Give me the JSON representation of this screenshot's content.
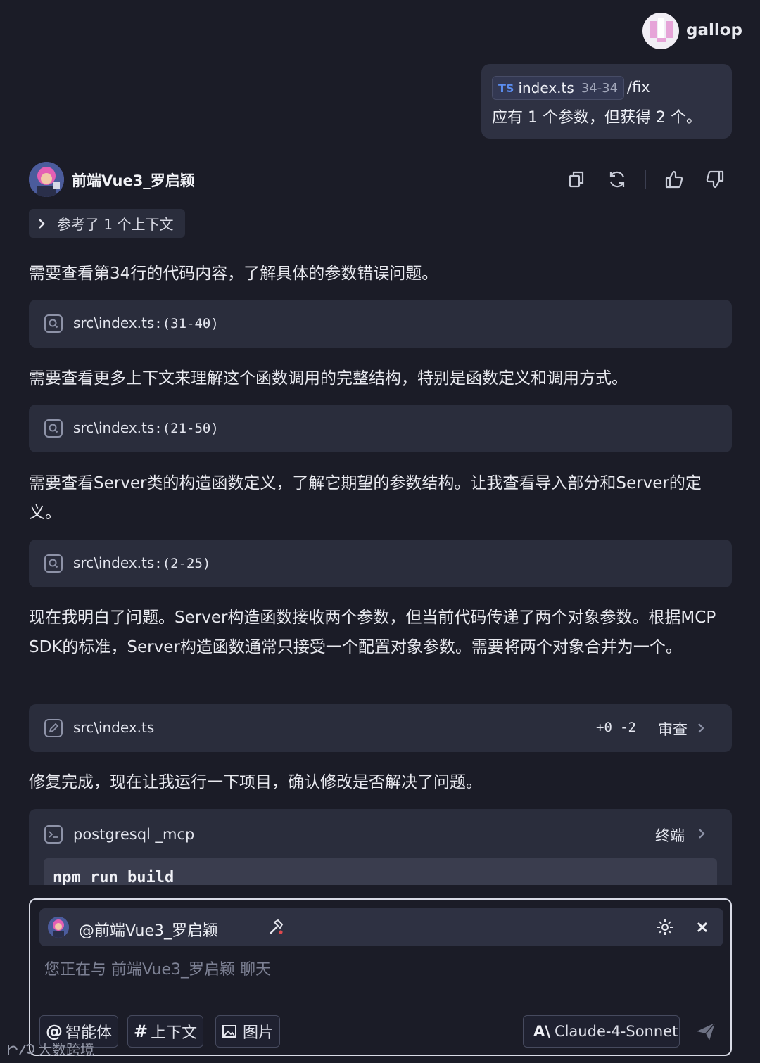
{
  "user": {
    "name": "gallop",
    "chip_badge": "TS",
    "chip_file": "index.ts",
    "chip_range": "34-34",
    "command": "/fix",
    "message": "应有 1 个参数，但获得 2 个。"
  },
  "agent": {
    "name": "前端Vue3_罗启颖",
    "reference": "参考了 1 个上下文"
  },
  "messages": {
    "p1": "需要查看第34行的代码内容，了解具体的参数错误问题。",
    "p2": "需要查看更多上下文来理解这个函数调用的完整结构，特别是函数定义和调用方式。",
    "p3": "需要查看Server类的构造函数定义，了解它期望的参数结构。让我查看导入部分和Server的定义。",
    "p4": "现在我明白了问题。Server构造函数接收两个参数，但当前代码传递了两个对象参数。根据MCP SDK的标准，Server构造函数通常只接受一个配置对象参数。需要将两个对象合并为一个。",
    "p5": "修复完成，现在让我运行一下项目，确认修改是否解决了问题。"
  },
  "cards": {
    "search1": {
      "file": "src\\index.ts",
      "range": ":(31-40)"
    },
    "search2": {
      "file": "src\\index.ts",
      "range": ":(21-50)"
    },
    "search3": {
      "file": "src\\index.ts",
      "range": ":(2-25)"
    },
    "edit": {
      "file": "src\\index.ts",
      "added": "+0",
      "removed": "-2",
      "action": "审查"
    },
    "terminal": {
      "project": "postgresql _mcp",
      "action": "终端",
      "command": "npm run build"
    }
  },
  "input": {
    "mention": "@前端Vue3_罗启颖",
    "placeholder": "您正在与 前端Vue3_罗启颖 聊天",
    "agent_btn_symbol": "@",
    "agent_btn": "智能体",
    "context_btn_symbol": "#",
    "context_btn": "上下文",
    "image_btn": "图片",
    "model_logo": "A\\",
    "model": "Claude-4-Sonnet"
  },
  "watermark": "大数跨境",
  "icons": [
    "copy-icon",
    "refresh-icon",
    "thumbs-up-icon",
    "thumbs-down-icon",
    "chevron-right-icon",
    "search-icon",
    "edit-icon",
    "terminal-icon",
    "settings-icon",
    "close-icon",
    "hammer-icon",
    "image-icon",
    "send-icon"
  ]
}
